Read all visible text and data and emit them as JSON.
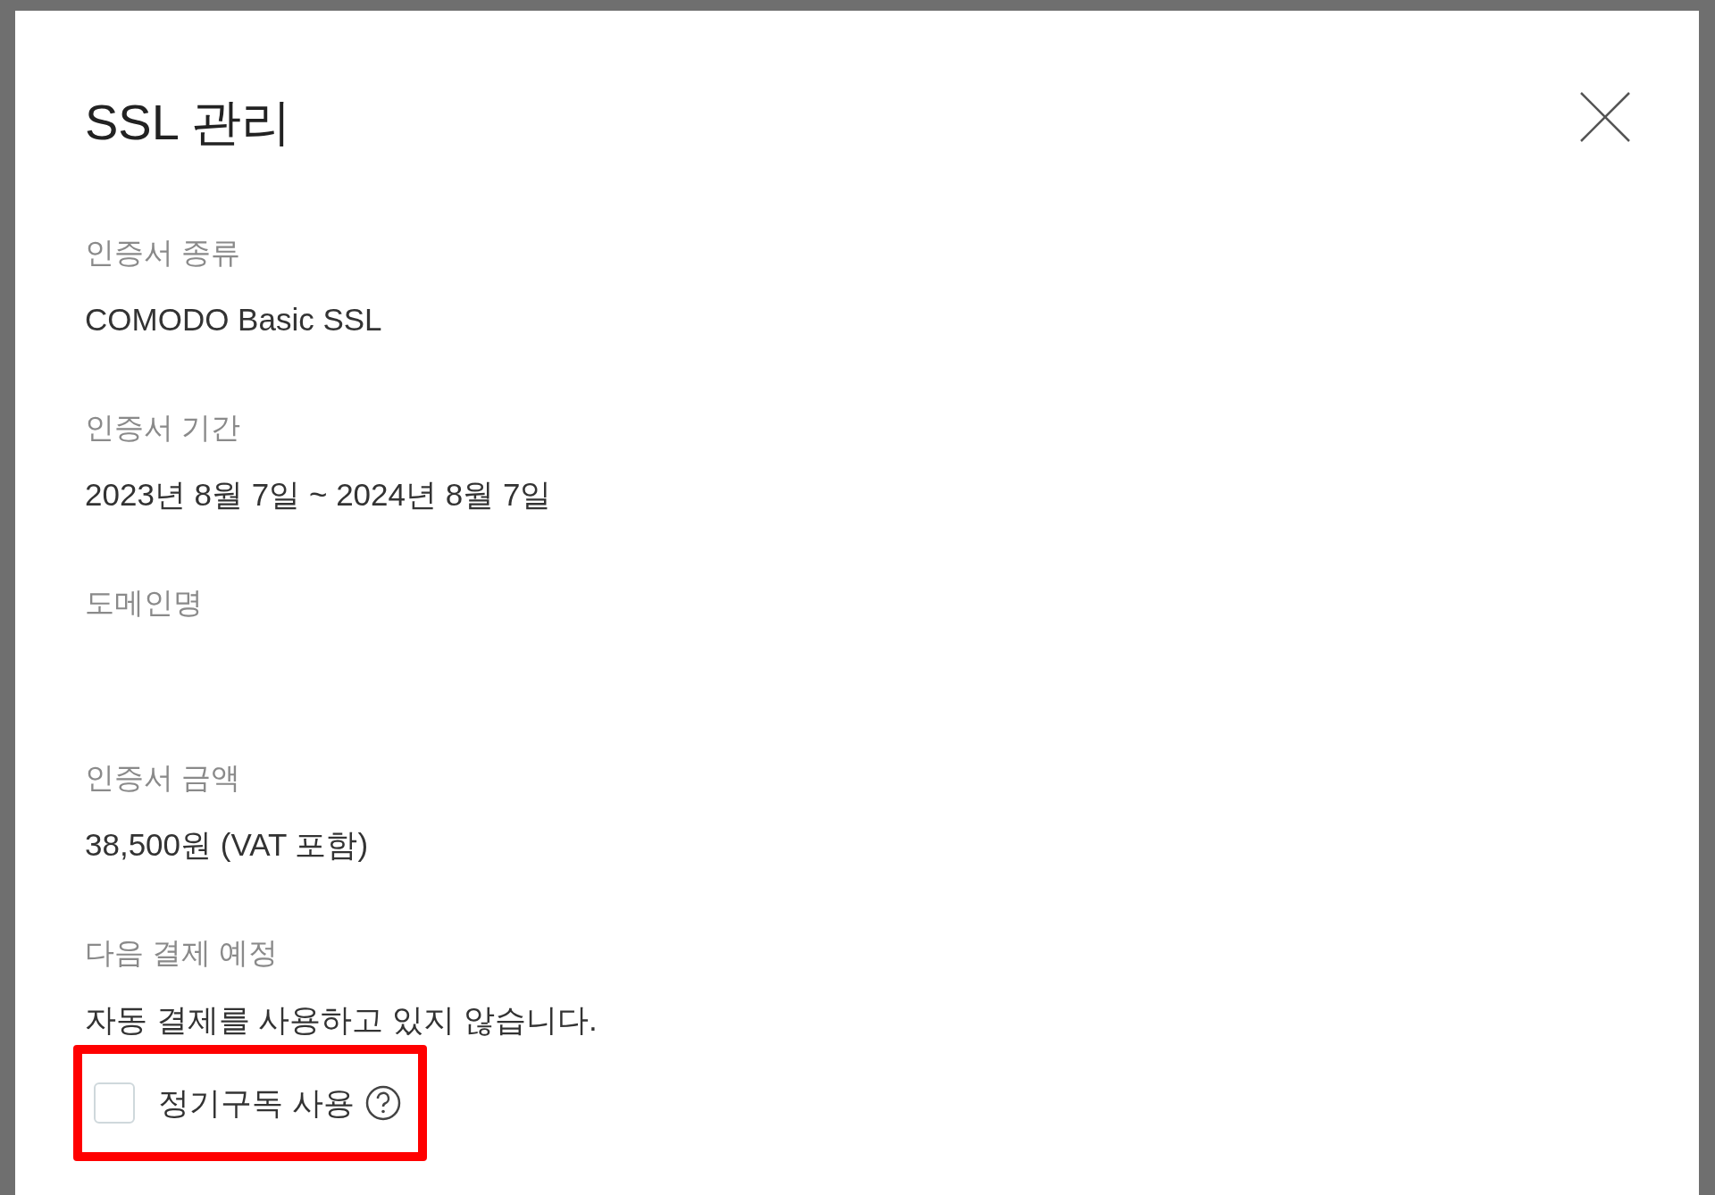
{
  "dialog": {
    "title": "SSL 관리",
    "fields": [
      {
        "label": "인증서 종류",
        "value": "COMODO Basic SSL"
      },
      {
        "label": "인증서 기간",
        "value": "2023년 8월 7일 ~ 2024년 8월 7일"
      },
      {
        "label": "도메인명"
      },
      {
        "label": "인증서 금액",
        "value": "38,500원 (VAT 포함)"
      },
      {
        "label": "다음 결제 예정",
        "value": "자동 결제를 사용하고 있지 않습니다."
      }
    ],
    "subscription": {
      "label": "정기구독 사용",
      "checked": false,
      "highlighted": true
    }
  }
}
